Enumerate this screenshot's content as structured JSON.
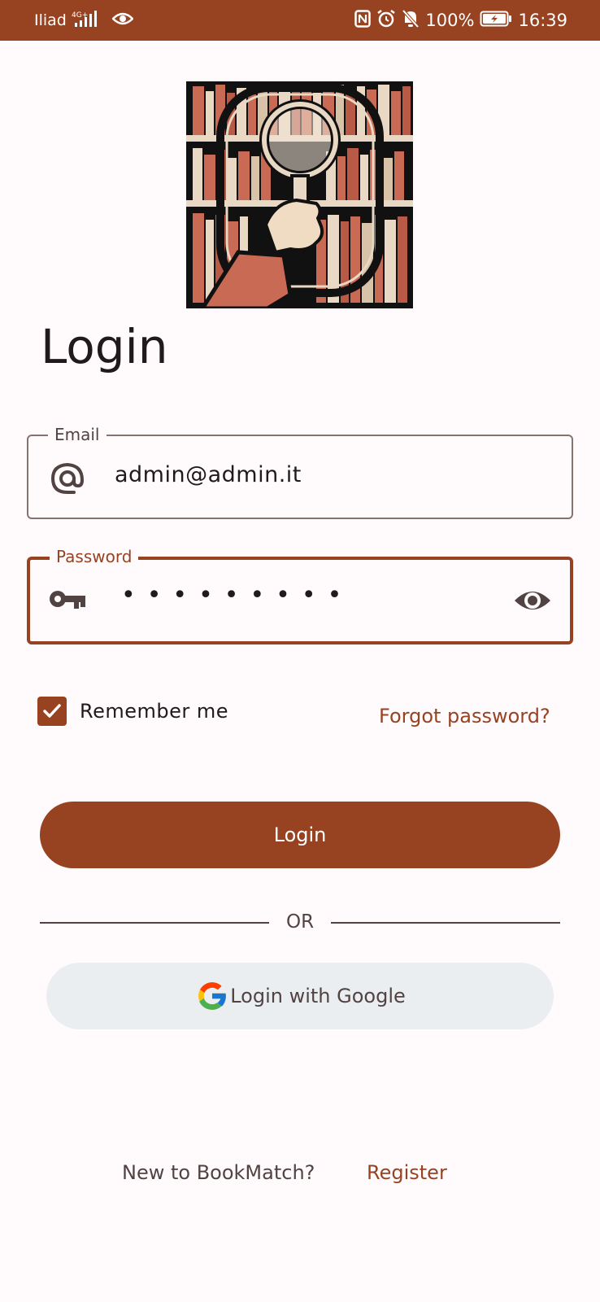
{
  "status_bar": {
    "carrier": "Iliad",
    "network": "4G+",
    "battery": "100%",
    "time": "16:39",
    "icons": [
      "signal-icon",
      "eye-icon",
      "nfc-icon",
      "alarm-icon",
      "bell-off-icon",
      "battery-charging-icon"
    ]
  },
  "logo": {
    "icon": "bookshelf-magnifier-logo"
  },
  "page": {
    "title": "Login"
  },
  "email_field": {
    "label": "Email",
    "value": "admin@admin.it",
    "icon": "at-icon"
  },
  "password_field": {
    "label": "Password",
    "value": "•••••••••",
    "icon": "key-icon",
    "toggle_icon": "eye-icon"
  },
  "remember": {
    "label": "Remember me",
    "checked": true
  },
  "forgot_password": {
    "label": "Forgot password?"
  },
  "login_button": {
    "label": "Login"
  },
  "divider": {
    "label": "OR"
  },
  "google_button": {
    "label": "Login with Google",
    "icon": "google-icon"
  },
  "footer": {
    "prompt": "New to BookMatch?",
    "register_label": "Register"
  },
  "colors": {
    "primary": "#974322",
    "surface": "#fffbfd",
    "google_button_bg": "#ebeef0",
    "outline": "#857370"
  }
}
